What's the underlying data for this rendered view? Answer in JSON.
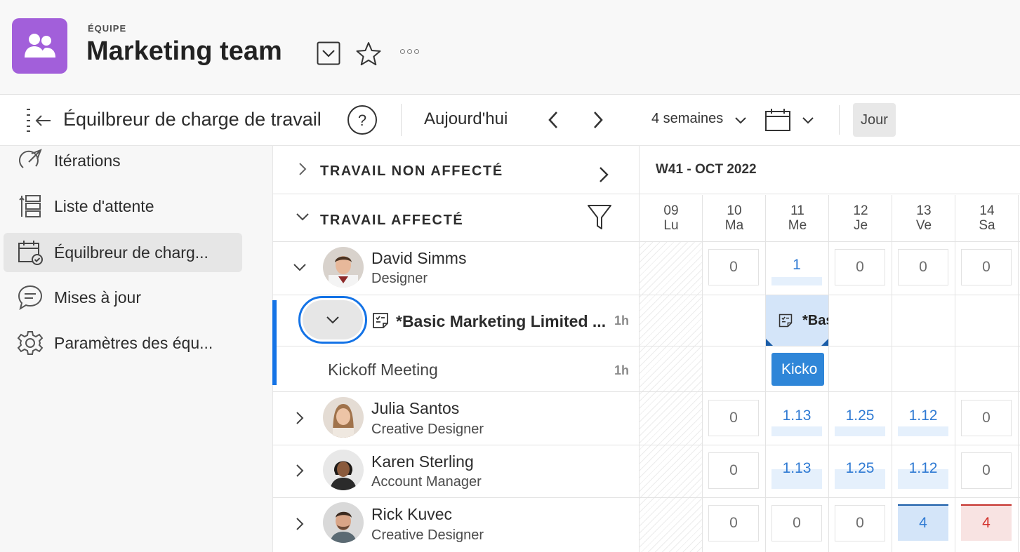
{
  "header": {
    "kicker": "ÉQUIPE",
    "title": "Marketing team",
    "icons": [
      "team-icon",
      "chevron-down-box-icon",
      "star-icon",
      "more-icon"
    ],
    "more_label": "○○○"
  },
  "toolbar": {
    "title": "Équilbreur de charge de travail",
    "today": "Aujourd'hui",
    "range": "4 semaines",
    "day_button": "Jour",
    "icons": [
      "collapse-panel-icon",
      "help-icon",
      "chevron-left-icon",
      "chevron-right-icon",
      "calendar-icon"
    ]
  },
  "sidebar": {
    "items": [
      {
        "label": "Itérations",
        "icon": "iterations-icon",
        "active": false
      },
      {
        "label": "Liste d'attente",
        "icon": "backlog-icon",
        "active": false
      },
      {
        "label": "Équilbreur de charg...",
        "icon": "workload-icon",
        "active": true
      },
      {
        "label": "Mises à jour",
        "icon": "comment-icon",
        "active": false
      },
      {
        "label": "Paramètres des équ...",
        "icon": "gear-icon",
        "active": false
      }
    ]
  },
  "grid": {
    "unassigned_label": "TRAVAIL NON AFFECTÉ",
    "assigned_label": "TRAVAIL AFFECTÉ",
    "week_label": "W41 - OCT 2022",
    "days": [
      {
        "num": "09",
        "name": "Lu"
      },
      {
        "num": "10",
        "name": "Ma"
      },
      {
        "num": "11",
        "name": "Me"
      },
      {
        "num": "12",
        "name": "Je"
      },
      {
        "num": "13",
        "name": "Ve"
      },
      {
        "num": "14",
        "name": "Sa"
      }
    ],
    "people": [
      {
        "name": "David Simms",
        "role": "Designer",
        "values": [
          "0",
          "1",
          "0",
          "0",
          "0"
        ]
      },
      {
        "name": "Julia Santos",
        "role": "Creative Designer",
        "values": [
          "0",
          "1.13",
          "1.25",
          "1.12",
          "0"
        ]
      },
      {
        "name": "Karen Sterling",
        "role": "Account Manager",
        "values": [
          "0",
          "1.13",
          "1.25",
          "1.12",
          "0"
        ]
      },
      {
        "name": "Rick Kuvec",
        "role": "Creative Designer",
        "values": [
          "0",
          "0",
          "0",
          "4",
          "4"
        ]
      }
    ],
    "project": {
      "title": "*Basic Marketing Limited ...",
      "hours": "1h",
      "bar_label": "*Bas"
    },
    "task": {
      "title": "Kickoff Meeting",
      "hours": "1h",
      "bar_label": "Kicko"
    }
  }
}
